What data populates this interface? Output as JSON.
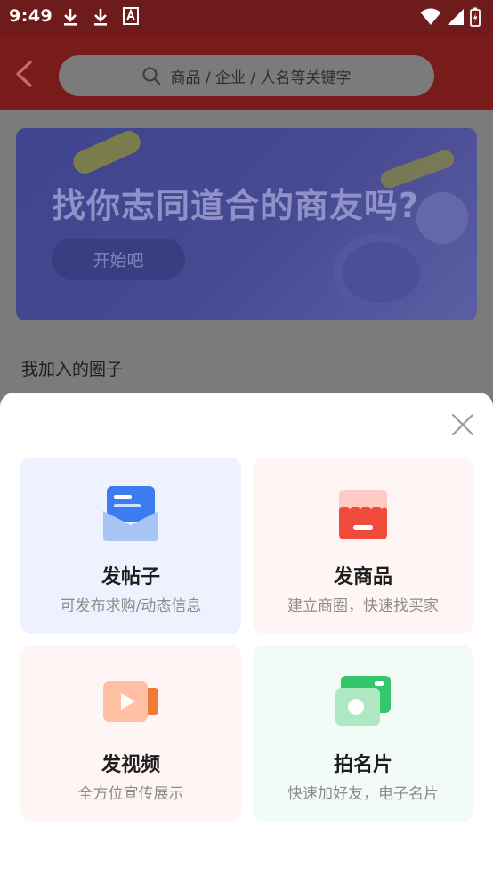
{
  "status_bar": {
    "time": "9:49"
  },
  "header": {
    "search_placeholder": "商品 / 企业 / 人名等关键字"
  },
  "banner": {
    "title": "找你志同道合的商友吗?",
    "start_button": "开始吧"
  },
  "section": {
    "title": "我加入的圈子"
  },
  "sheet": {
    "cards": [
      {
        "name": "发帖子",
        "desc": "可发布求购/动态信息",
        "icon": "post-envelope-icon"
      },
      {
        "name": "发商品",
        "desc": "建立商圈，快速找买家",
        "icon": "shop-icon"
      },
      {
        "name": "发视频",
        "desc": "全方位宣传展示",
        "icon": "video-camera-icon"
      },
      {
        "name": "拍名片",
        "desc": "快速加好友，电子名片",
        "icon": "camera-card-icon"
      }
    ]
  },
  "colors": {
    "header_bg": "#7a1b1b",
    "status_bg": "#6e1b1b",
    "accent_blue": "#3b7cf0",
    "accent_red": "#f04a3a",
    "accent_orange": "#f07a3a",
    "accent_green": "#35c56a"
  }
}
